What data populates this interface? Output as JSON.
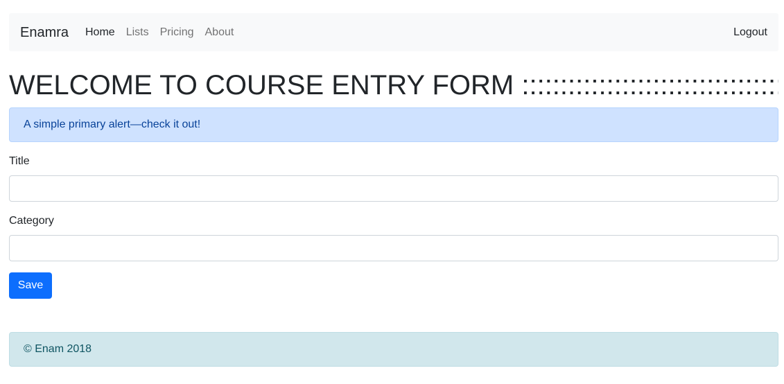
{
  "navbar": {
    "brand": "Enamra",
    "links": [
      {
        "label": "Home",
        "active": true
      },
      {
        "label": "Lists",
        "active": false
      },
      {
        "label": "Pricing",
        "active": false
      },
      {
        "label": "About",
        "active": false
      }
    ],
    "logout": "Logout"
  },
  "heading": "WELCOME TO COURSE ENTRY FORM :::::::::::::::::::::::::::::::::::::::",
  "alert": "A simple primary alert—check it out!",
  "form": {
    "title_label": "Title",
    "title_value": "",
    "category_label": "Category",
    "category_value": "",
    "save_label": "Save"
  },
  "footer": "© Enam 2018",
  "colors": {
    "primary": "#0d6efd",
    "alert_bg": "#cfe2ff",
    "footer_bg": "#d1e7ec",
    "navbar_bg": "#f8f9fa"
  }
}
